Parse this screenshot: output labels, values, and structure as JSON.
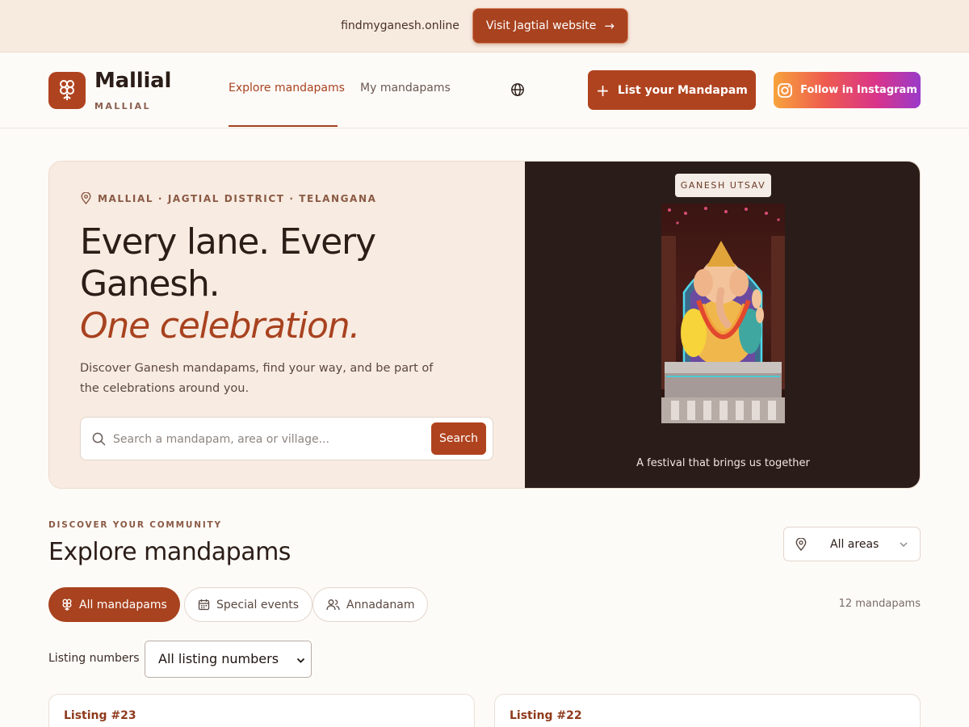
{
  "banner": {
    "domain": "findmyganesh.online",
    "visit_label": "Visit Jagtial website",
    "visit_icon": "arrow-right-icon"
  },
  "header": {
    "brand_name": "Mallial",
    "brand_sub": "MALLIAL",
    "logo_icon": "ganesh-logo-icon",
    "nav": [
      "Explore mandapams",
      "My mandapams"
    ],
    "active_nav": "Explore mandapams",
    "language_icon": "globe-icon",
    "list_button": "List your Mandapam",
    "instagram_button": "Follow in Instagram"
  },
  "hero": {
    "location": "MALLIAL · JAGTIAL DISTRICT · TELANGANA",
    "headline_line1": "Every lane. Every",
    "headline_line2": "Ganesh.",
    "headline_italic": "One celebration.",
    "description": "Discover Ganesh mandapams, find your way, and be part of the celebrations around you.",
    "search_placeholder": "Search a mandapam, area or village...",
    "search_value": "",
    "search_button": "Search",
    "badge": "GANESH UTSAV",
    "caption": "A festival that brings us together"
  },
  "explore": {
    "eyebrow": "DISCOVER YOUR COMMUNITY",
    "title": "Explore mandapams",
    "area_filter": "All areas",
    "chips": [
      {
        "label": "All mandapams",
        "icon": "ganesh-icon",
        "active": true
      },
      {
        "label": "Special events",
        "icon": "calendar-icon",
        "active": false
      },
      {
        "label": "Annadanam",
        "icon": "people-icon",
        "active": false
      }
    ],
    "count": "12 mandapams",
    "listing_numbers_label": "Listing numbers",
    "listing_numbers_value": "All listing numbers",
    "listing_numbers_options": [
      "All listing numbers"
    ],
    "cards": [
      {
        "title": "Listing #23"
      },
      {
        "title": "Listing #22"
      }
    ]
  },
  "colors": {
    "accent": "#a8421f",
    "banner_bg": "#f7ebe0",
    "hero_bg": "#f8ebe1",
    "hero_dark": "#2a1d19"
  }
}
